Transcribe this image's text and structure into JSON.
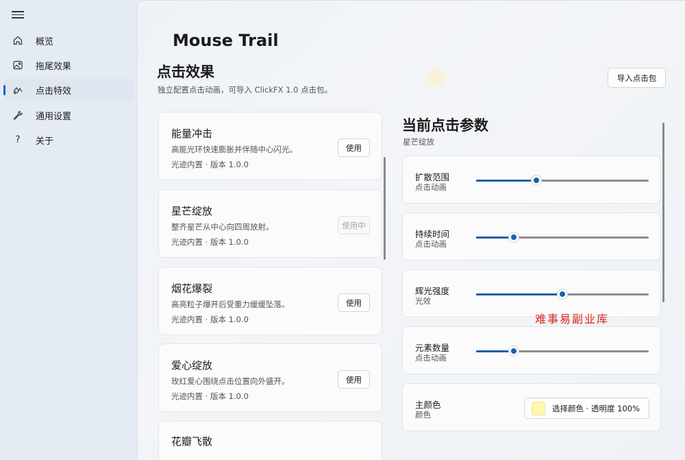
{
  "sidebar": {
    "items": [
      {
        "label": "概览",
        "icon": "home-icon"
      },
      {
        "label": "拖尾效果",
        "icon": "image-icon"
      },
      {
        "label": "点击特效",
        "icon": "sparkle-effect-icon",
        "active": true
      },
      {
        "label": "通用设置",
        "icon": "wrench-icon"
      },
      {
        "label": "关于",
        "icon": "question-icon"
      }
    ]
  },
  "app_title": "Mouse Trail",
  "section": {
    "title": "点击效果",
    "description": "独立配置点击动画，可导入 ClickFX 1.0 点击包。",
    "import_button": "导入点击包"
  },
  "effects": [
    {
      "name": "能量冲击",
      "description": "高能光环快速膨胀并伴随中心闪光。",
      "meta": "光迹内置 · 版本 1.0.0",
      "button": "使用",
      "in_use": false
    },
    {
      "name": "星芒绽放",
      "description": "整齐星芒从中心向四周放射。",
      "meta": "光迹内置 · 版本 1.0.0",
      "button": "使用中",
      "in_use": true
    },
    {
      "name": "烟花爆裂",
      "description": "高亮粒子爆开后受重力缓缓坠落。",
      "meta": "光迹内置 · 版本 1.0.0",
      "button": "使用",
      "in_use": false
    },
    {
      "name": "爱心绽放",
      "description": "玫红爱心围绕点击位置向外盛开。",
      "meta": "光迹内置 · 版本 1.0.0",
      "button": "使用",
      "in_use": false
    },
    {
      "name": "花瓣飞散",
      "description": "",
      "meta": "",
      "button": "",
      "in_use": false
    }
  ],
  "params": {
    "title": "当前点击参数",
    "subtitle": "星芒绽放",
    "sliders": [
      {
        "label": "扩散范围",
        "sub": "点击动画",
        "value": 0.35
      },
      {
        "label": "持续时间",
        "sub": "点击动画",
        "value": 0.22
      },
      {
        "label": "辉光强度",
        "sub": "光效",
        "value": 0.5
      },
      {
        "label": "元素数量",
        "sub": "点击动画",
        "value": 0.22
      }
    ],
    "color": {
      "label": "主颜色",
      "sub": "颜色",
      "button": "选择颜色 · 透明度 100%",
      "swatch": "#fff7ab"
    }
  },
  "watermark": "难事易副业库",
  "colors": {
    "accent": "#1c5ea8",
    "nav_indicator": "#0067c0"
  }
}
